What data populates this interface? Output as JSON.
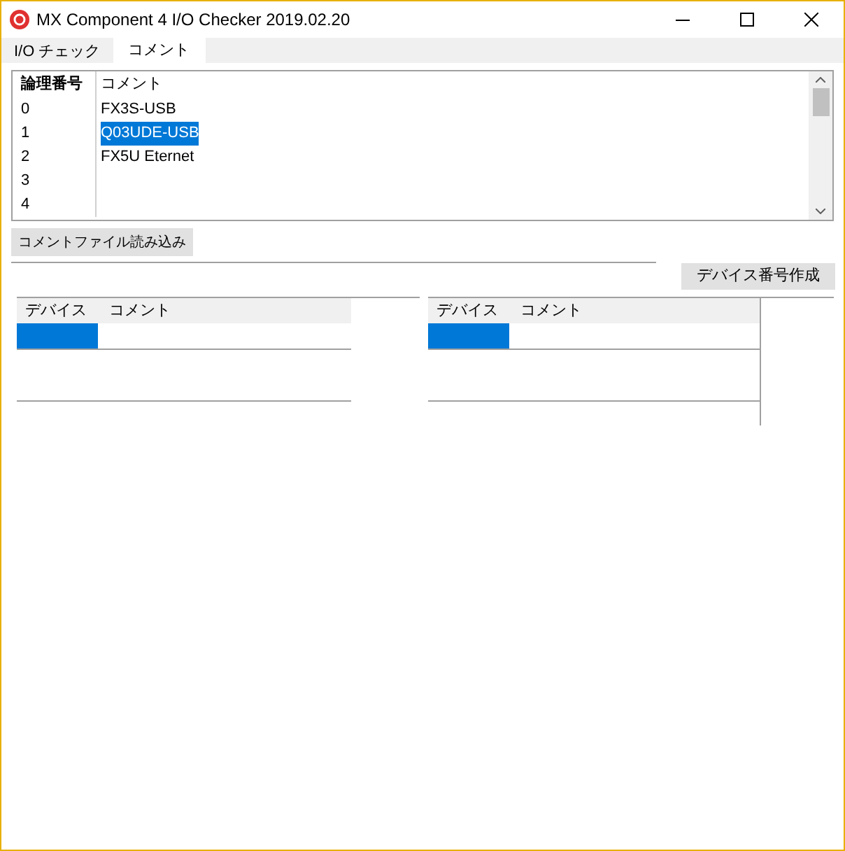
{
  "window": {
    "title": "MX Component 4 I/O Checker 2019.02.20"
  },
  "tabs": [
    {
      "label": "I/O チェック",
      "selected": false
    },
    {
      "label": "コメント",
      "selected": true
    }
  ],
  "comment_table": {
    "columns": [
      "論理番号",
      "コメント"
    ],
    "rows": [
      {
        "number": "0",
        "comment": "FX3S-USB",
        "selected": false
      },
      {
        "number": "1",
        "comment": "Q03UDE-USB",
        "selected": true
      },
      {
        "number": "2",
        "comment": "FX5U Eternet",
        "selected": false
      },
      {
        "number": "3",
        "selected": false
      },
      {
        "number": "4",
        "selected": false
      }
    ]
  },
  "load_button": "コメントファイル読み込み",
  "create_button": "デバイス番号作成",
  "device_tables": [
    {
      "columns": [
        "デバイス",
        "コメント"
      ],
      "rows": [
        {
          "selected": true
        }
      ]
    },
    {
      "columns": [
        "デバイス",
        "コメント"
      ],
      "rows": [
        {
          "selected": true
        }
      ]
    }
  ]
}
